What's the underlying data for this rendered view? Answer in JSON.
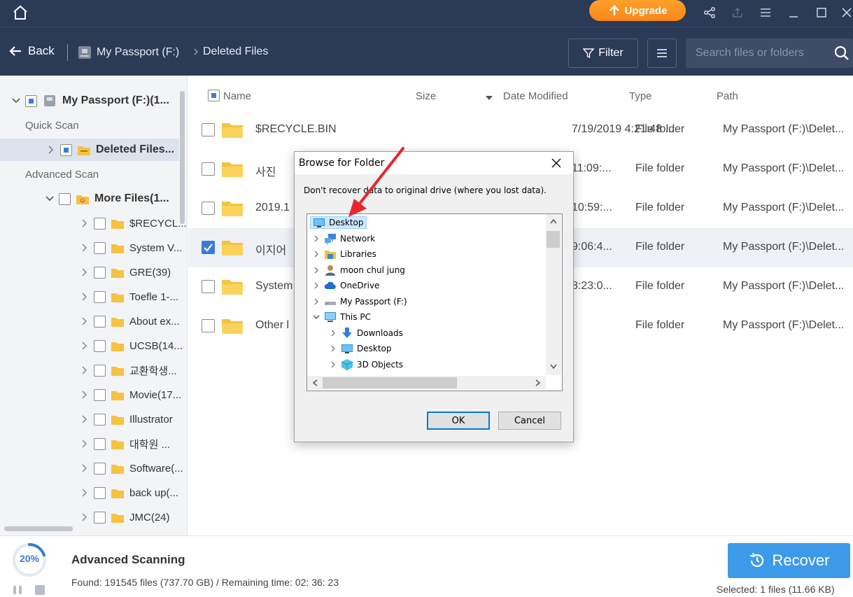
{
  "titlebar": {
    "upgrade_label": "Upgrade"
  },
  "navbar": {
    "back_label": "Back",
    "crumb_drive": "My Passport (F:)",
    "crumb_folder": "Deleted Files",
    "filter_label": "Filter",
    "search_placeholder": "Search files or folders"
  },
  "sidebar": {
    "root_label": "My Passport (F:)(1...",
    "quick_scan_label": "Quick Scan",
    "deleted_files_label": "Deleted Files...",
    "advanced_scan_label": "Advanced Scan",
    "more_files_label": "More Files(1...",
    "items": [
      "$RECYCL...",
      "System V...",
      "GRE(39)",
      "Toefle 1-...",
      "About ex...",
      "UCSB(14...",
      "교환학생...",
      "Movie(17...",
      "Illustrator",
      "대학원 ...",
      "Software(...",
      "back up(...",
      "JMC(24)"
    ]
  },
  "table": {
    "headers": {
      "name": "Name",
      "size": "Size",
      "date": "Date Modified",
      "type": "Type",
      "path": "Path"
    },
    "rows": [
      {
        "name": "$RECYCLE.BIN",
        "date": "7/19/2019 4:21:48 ...",
        "type": "File folder",
        "path": "My Passport (F:)\\Delet...",
        "checked": false
      },
      {
        "name": "사진",
        "date": "11:09:...",
        "type": "File folder",
        "path": "My Passport (F:)\\Delet...",
        "checked": false
      },
      {
        "name": "2019.1",
        "date": "10:59:...",
        "type": "File folder",
        "path": "My Passport (F:)\\Delet...",
        "checked": false
      },
      {
        "name": "이지어",
        "date": "9:06:4...",
        "type": "File folder",
        "path": "My Passport (F:)\\Delet...",
        "checked": true
      },
      {
        "name": "System",
        "date": "8:23:0...",
        "type": "File folder",
        "path": "My Passport (F:)\\Delet...",
        "checked": false
      },
      {
        "name": "Other l",
        "date": "",
        "type": "File folder",
        "path": "My Passport (F:)\\Delet...",
        "checked": false
      }
    ]
  },
  "bottom": {
    "progress_text": "20%",
    "progress_value": 20,
    "scan_title": "Advanced Scanning",
    "found_text": "Found: 191545 files (737.70 GB) / Remaining time: 02: 36: 23",
    "recover_label": "Recover",
    "selected_text": "Selected: 1 files (11.66 KB)"
  },
  "dialog": {
    "title": "Browse for Folder",
    "message": "Don't recover data to original drive (where you lost data).",
    "tree": {
      "desktop": "Desktop",
      "network": "Network",
      "libraries": "Libraries",
      "user": "moon chul jung",
      "onedrive": "OneDrive",
      "passport": "My Passport (F:)",
      "thispc": "This PC",
      "downloads": "Downloads",
      "desktop2": "Desktop",
      "objects3d": "3D Objects"
    },
    "ok_label": "OK",
    "cancel_label": "Cancel"
  },
  "colors": {
    "chrome": "#2b3a55",
    "accent": "#3d9ae8",
    "upgrade": "#f7871a",
    "folder": "#f5c242",
    "annotation_arrow": "#e8262b"
  }
}
